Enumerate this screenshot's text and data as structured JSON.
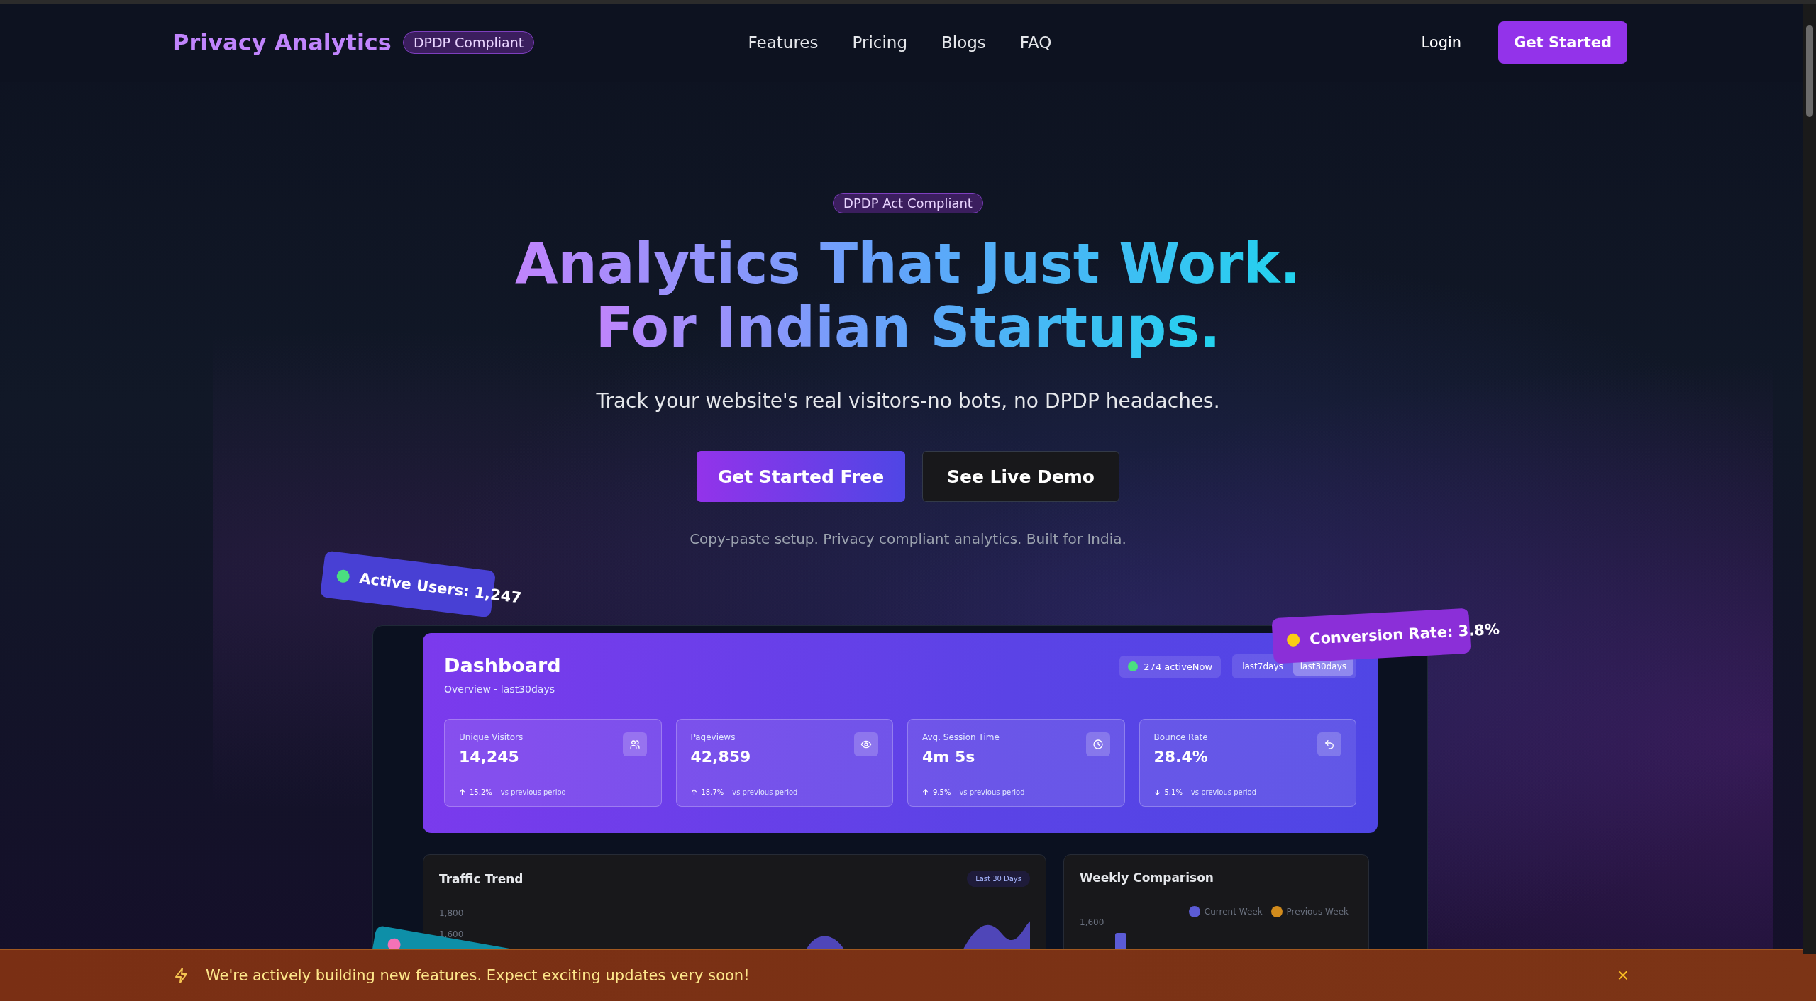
{
  "nav": {
    "logo": "Privacy Analytics",
    "badge": "DPDP Compliant",
    "links": [
      "Features",
      "Pricing",
      "Blogs",
      "FAQ"
    ],
    "login": "Login",
    "cta": "Get Started"
  },
  "hero": {
    "badge": "DPDP Act Compliant",
    "title_lines": [
      "Analytics That Just Work.",
      "For Indian Startups."
    ],
    "subtitle": "Track your website's real visitors-no bots, no DPDP headaches.",
    "primary_button": "Get Started Free",
    "secondary_button": "See Live Demo",
    "caption": "Copy-paste setup. Privacy compliant analytics. Built for India."
  },
  "floating_badges": [
    {
      "text": "Active Users: 1,247",
      "color": "#4ade80"
    },
    {
      "text": "Conversion Rate: 3.8%",
      "color": "#facc15"
    },
    {
      "color": "#f472b6"
    }
  ],
  "dashboard": {
    "title": "Dashboard",
    "subtitle": "Overview - last30days",
    "active_now": "274 activeNow",
    "ranges": [
      {
        "label": "last7days",
        "selected": false
      },
      {
        "label": "last30days",
        "selected": true
      }
    ],
    "stats": [
      {
        "label": "Unique Visitors",
        "value": "14,245",
        "change": "15.2%",
        "kind": "up",
        "note": "vs previous period"
      },
      {
        "label": "Pageviews",
        "value": "42,859",
        "change": "18.7%",
        "kind": "up",
        "note": "vs previous period"
      },
      {
        "label": "Avg. Session Time",
        "value": "4m 5s",
        "change": "9.5%",
        "kind": "up",
        "note": "vs previous period"
      },
      {
        "label": "Bounce Rate",
        "value": "28.4%",
        "change": "5.1%",
        "kind": "down",
        "note": "vs previous period"
      }
    ],
    "traffic": {
      "title": "Traffic Trend",
      "badge": "Last 30 Days",
      "ticks": [
        "1,800",
        "1,600"
      ]
    },
    "weekly": {
      "title": "Weekly Comparison",
      "legend": [
        {
          "label": "Current Week",
          "color": "#5b5bd6"
        },
        {
          "label": "Previous Week",
          "color": "#d18b1c"
        }
      ],
      "ticks": [
        "1,600"
      ]
    }
  },
  "banner": {
    "text": "We're actively building new features. Expect exciting updates very soon!",
    "close": "×"
  }
}
